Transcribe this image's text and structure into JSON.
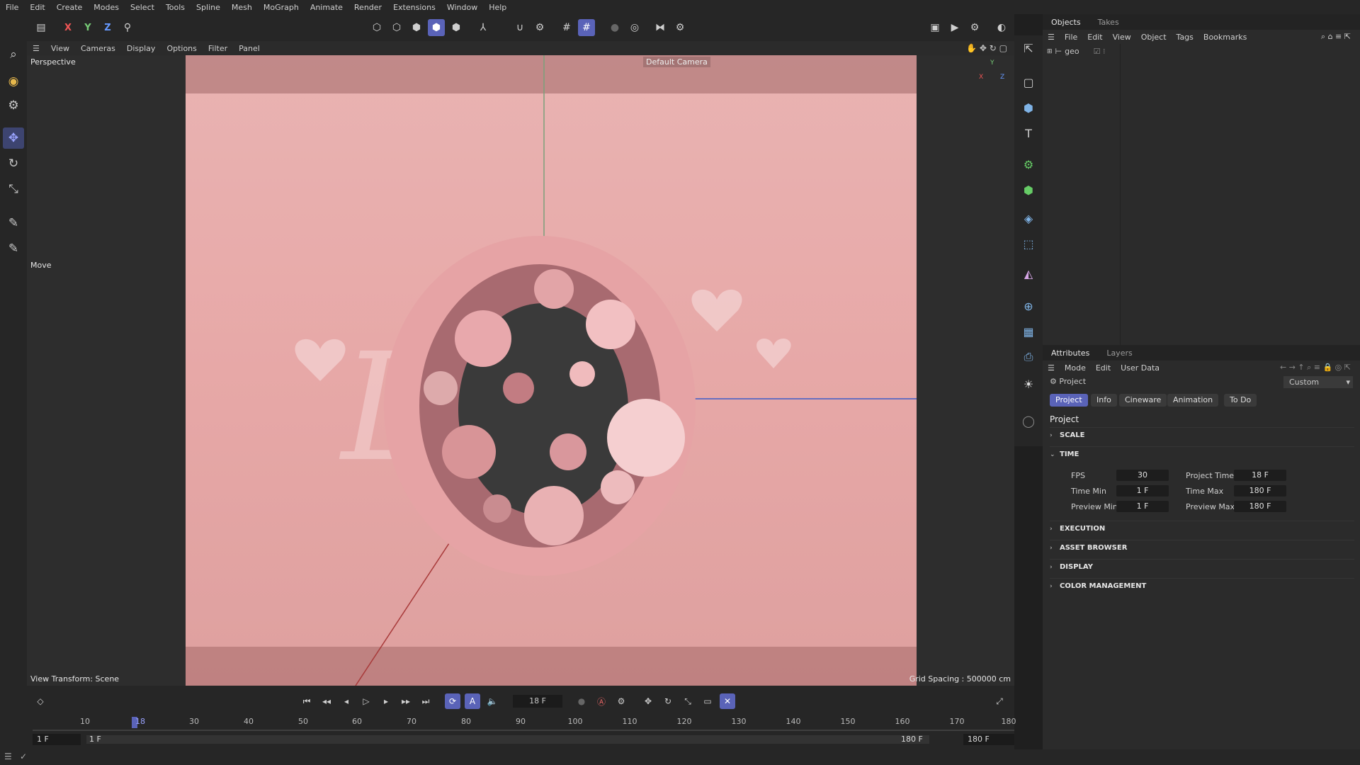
{
  "menubar": {
    "items": [
      "File",
      "Edit",
      "Create",
      "Modes",
      "Select",
      "Tools",
      "Spline",
      "Mesh",
      "MoGraph",
      "Animate",
      "Render",
      "Extensions",
      "Window",
      "Help"
    ]
  },
  "axis_toggles": {
    "x": "X",
    "y": "Y",
    "z": "Z"
  },
  "viewport_menu": {
    "items": [
      "View",
      "Cameras",
      "Display",
      "Options",
      "Filter",
      "Panel"
    ]
  },
  "viewport": {
    "view_name": "Perspective",
    "camera_label": "Default Camera",
    "active_tool": "Move",
    "view_transform": "View Transform: Scene",
    "grid_spacing": "Grid Spacing : 500000 cm",
    "axis_x": "X",
    "axis_y": "Y",
    "axis_z": "Z"
  },
  "objects_panel": {
    "tabs": [
      "Objects",
      "Takes"
    ],
    "menu": [
      "File",
      "Edit",
      "View",
      "Object",
      "Tags",
      "Bookmarks"
    ],
    "tree": [
      {
        "name": "geo"
      }
    ]
  },
  "attributes_panel": {
    "tabs": [
      "Attributes",
      "Layers"
    ],
    "menu": [
      "Mode",
      "Edit",
      "User Data"
    ],
    "context_label": "Project",
    "preset_value": "Custom",
    "subtabs": [
      "Project",
      "Info",
      "Cineware",
      "Animation",
      "To Do"
    ],
    "heading": "Project",
    "sections": {
      "scale": "SCALE",
      "time": "TIME",
      "execution": "EXECUTION",
      "asset_browser": "ASSET BROWSER",
      "display": "DISPLAY",
      "color_management": "COLOR MANAGEMENT"
    },
    "time": {
      "fps_label": "FPS",
      "fps_value": "30",
      "project_time_label": "Project Time",
      "project_time_value": "18 F",
      "time_min_label": "Time Min",
      "time_min_value": "1 F",
      "time_max_label": "Time Max",
      "time_max_value": "180 F",
      "preview_min_label": "Preview Min",
      "preview_min_value": "1 F",
      "preview_max_label": "Preview Max",
      "preview_max_value": "180 F"
    }
  },
  "timeline": {
    "current_frame": "18 F",
    "playhead_label": "18",
    "ruler_ticks": [
      "10",
      "30",
      "40",
      "50",
      "60",
      "70",
      "80",
      "90",
      "100",
      "110",
      "120",
      "130",
      "140",
      "150",
      "160",
      "170",
      "180"
    ],
    "range_start": "1 F",
    "range_start_inner": "1 F",
    "range_end_inner": "180 F",
    "range_end": "180 F"
  },
  "colors": {
    "accent": "#5a63b8",
    "background": "#262626",
    "viewport_pink": "#e7a8a7",
    "axis_x": "#d44",
    "axis_y": "#6c6",
    "axis_z": "#48f"
  }
}
